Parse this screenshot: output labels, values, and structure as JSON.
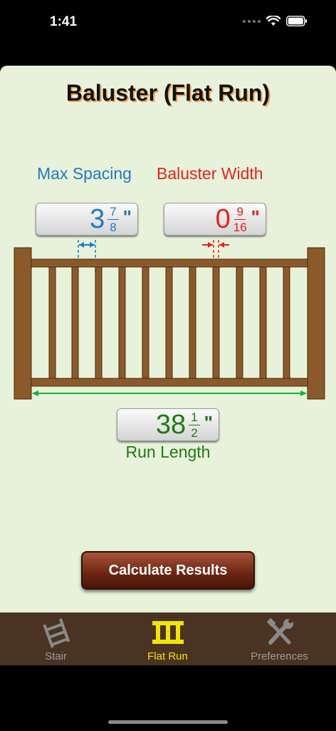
{
  "status_bar": {
    "time": "1:41"
  },
  "page": {
    "title": "Baluster (Flat Run)"
  },
  "max_spacing": {
    "label": "Max Spacing",
    "whole": "3",
    "numerator": "7",
    "denominator": "8",
    "unit": "\""
  },
  "baluster_width": {
    "label": "Baluster Width",
    "whole": "0",
    "numerator": "9",
    "denominator": "16",
    "unit": "\""
  },
  "run_length": {
    "label": "Run Length",
    "whole": "38",
    "numerator": "1",
    "denominator": "2",
    "unit": "\""
  },
  "actions": {
    "calculate_label": "Calculate Results"
  },
  "tabs": [
    {
      "label": "Stair",
      "icon": "stair-icon",
      "selected": false
    },
    {
      "label": "Flat Run",
      "icon": "flat-run-icon",
      "selected": true
    },
    {
      "label": "Preferences",
      "icon": "tools-icon",
      "selected": false
    }
  ],
  "colors": {
    "background": "#e8f2da",
    "spacing": "#1f78c8",
    "width": "#e0241c",
    "run": "#1e7a12",
    "wood": "#8b5a2b",
    "tab_bar": "#4a3322",
    "tab_selected": "#f0e40a"
  }
}
